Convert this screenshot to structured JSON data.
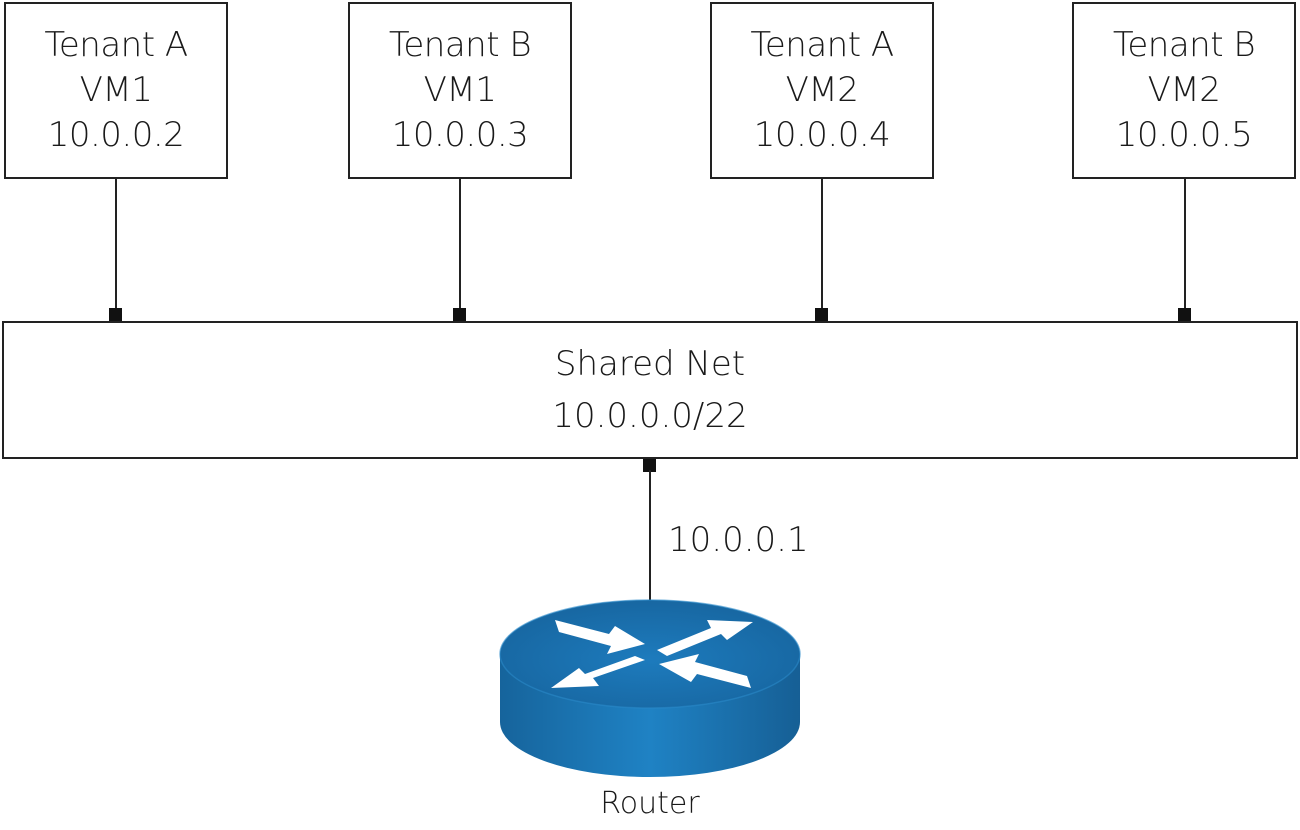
{
  "vms": [
    {
      "tenant": "Tenant A",
      "vm": "VM1",
      "ip": "10.0.0.2"
    },
    {
      "tenant": "Tenant B",
      "vm": "VM1",
      "ip": "10.0.0.3"
    },
    {
      "tenant": "Tenant A",
      "vm": "VM2",
      "ip": "10.0.0.4"
    },
    {
      "tenant": "Tenant B",
      "vm": "VM2",
      "ip": "10.0.0.5"
    }
  ],
  "network": {
    "name": "Shared Net",
    "cidr": "10.0.0.0/22"
  },
  "router": {
    "gateway_ip": "10.0.0.1",
    "label": "Router",
    "icon": "router-icon"
  },
  "colors": {
    "router_top": "#1a6ea8",
    "router_side": "#1f7dbf",
    "line": "#222222"
  }
}
